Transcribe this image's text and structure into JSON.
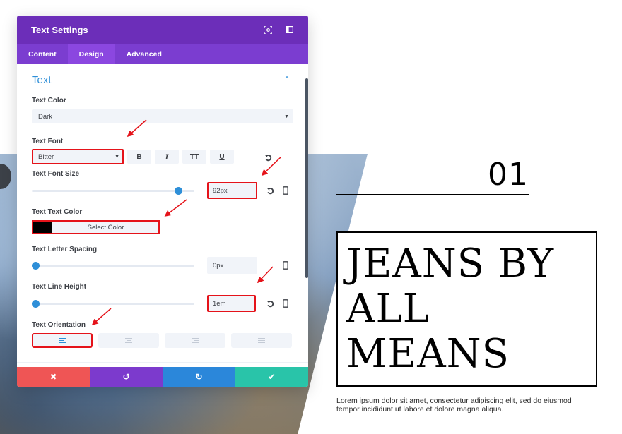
{
  "modal": {
    "title": "Text Settings",
    "header_icons": [
      "focus-icon",
      "sidebar-toggle-icon"
    ],
    "tabs": [
      {
        "label": "Content",
        "active": false
      },
      {
        "label": "Design",
        "active": true
      },
      {
        "label": "Advanced",
        "active": false
      }
    ],
    "section": {
      "title": "Text",
      "collapse_icon": "chevron-up-icon"
    },
    "fields": {
      "text_color": {
        "label": "Text Color",
        "value": "Dark"
      },
      "text_font": {
        "label": "Text Font",
        "value": "Bitter",
        "style_buttons": [
          "B",
          "I",
          "TT",
          "U"
        ]
      },
      "text_font_size": {
        "label": "Text Font Size",
        "value": "92px",
        "slider_fraction": 0.9
      },
      "text_text_color": {
        "label": "Text Text Color",
        "swatch": "#000000",
        "button_label": "Select Color"
      },
      "text_letter_spacing": {
        "label": "Text Letter Spacing",
        "value": "0px",
        "slider_fraction": 0.0
      },
      "text_line_height": {
        "label": "Text Line Height",
        "value": "1em",
        "slider_fraction": 0.0
      },
      "text_orientation": {
        "label": "Text Orientation",
        "options": [
          "left",
          "center",
          "right",
          "justify"
        ],
        "selected": "left"
      }
    },
    "footer": [
      {
        "name": "cancel",
        "icon": "✖",
        "color": "#ef5555"
      },
      {
        "name": "undo",
        "icon": "↺",
        "color": "#7c3acd"
      },
      {
        "name": "redo",
        "icon": "↻",
        "color": "#2b87da"
      },
      {
        "name": "save",
        "icon": "✔",
        "color": "#29c4a9"
      }
    ]
  },
  "page": {
    "number": "01",
    "headline_lines": [
      "JEANS BY",
      "ALL",
      "MEANS"
    ],
    "body_text": "Lorem ipsum dolor sit amet, consectetur adipiscing elit, sed do eiusmod tempor incididunt ut labore et dolore magna aliqua."
  },
  "colors": {
    "header": "#6c2eb9",
    "tabs": "#7b3dd0",
    "accent": "#2e8fd8",
    "highlight": "#e5131a"
  }
}
